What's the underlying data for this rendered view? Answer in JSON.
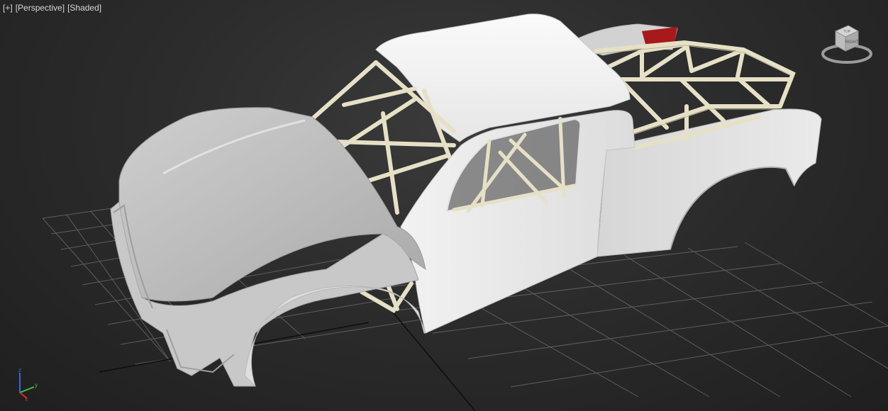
{
  "viewport": {
    "menu": {
      "general_label": "[+]",
      "view_label": "[Perspective]",
      "shading_label": "[Shaded]"
    },
    "viewcube": {
      "face_label": "RIGHT",
      "top_label": "TOP"
    },
    "axis_tripod": {
      "x": "x",
      "y": "y",
      "z": "z"
    },
    "colors": {
      "background": "#2c2c2c",
      "grid": "#7a7a7a",
      "body_shell": "#e8e8e8",
      "roll_cage": "#e6e1c6",
      "rear_light": "#a8191c",
      "axis_x": "#d92a2a",
      "axis_y": "#3fbf3f",
      "axis_z": "#3a66d9"
    }
  }
}
